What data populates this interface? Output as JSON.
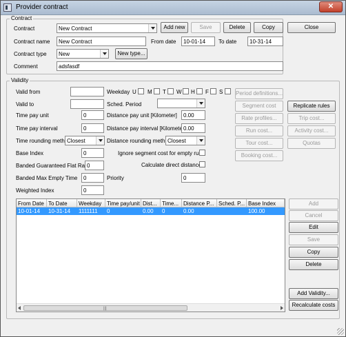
{
  "window": {
    "title": "Provider contract",
    "close_glyph": "✕"
  },
  "contract": {
    "group_label": "Contract",
    "contract_label": "Contract",
    "contract_value": "New Contract",
    "add_new": "Add new",
    "save": "Save",
    "delete": "Delete",
    "copy": "Copy",
    "name_label": "Contract name",
    "name_value": "New Contract",
    "from_date_label": "From date",
    "from_date_value": "10-01-14",
    "to_date_label": "To date",
    "to_date_value": "10-31-14",
    "type_label": "Contract type",
    "type_value": "New",
    "new_type": "New type...",
    "comment_label": "Comment",
    "comment_value": "adsfasdf"
  },
  "close_button": "Close",
  "validity": {
    "group_label": "Validity",
    "valid_from_label": "Valid from",
    "valid_from_value": "",
    "valid_to_label": "Valid to",
    "valid_to_value": "",
    "weekday_label": "Weekday",
    "weekdays": [
      "U",
      "M",
      "T",
      "W",
      "H",
      "F",
      "S"
    ],
    "sched_period_label": "Sched. Period",
    "sched_period_value": "",
    "time_pay_unit_label": "Time pay unit",
    "time_pay_unit_value": "0",
    "distance_pay_unit_label": "Distance pay unit [Kilometer]",
    "distance_pay_unit_value": "0.00",
    "time_pay_interval_label": "Time pay interval",
    "time_pay_interval_value": "0",
    "distance_pay_interval_label": "Distance pay interval [Kilometer]",
    "distance_pay_interval_value": "0.00",
    "time_rounding_label": "Time rounding meth",
    "time_rounding_value": "Closest",
    "distance_rounding_label": "Distance rounding meth",
    "distance_rounding_value": "Closest",
    "base_index_label": "Base Index",
    "base_index_value": "0",
    "ignore_segment_label": "Ignore segment cost for empty runs",
    "banded_flat_label": "Banded Guaranteed Flat Rate",
    "banded_flat_value": "0",
    "calc_direct_label": "Calculate direct distance",
    "banded_max_label": "Banded Max Empty Time",
    "banded_max_value": "0",
    "priority_label": "Priority",
    "priority_value": "0",
    "weighted_index_label": "Weighted Index",
    "weighted_index_value": "0",
    "period_definitions": "Period definitions...",
    "segment_cost": "Segment cost",
    "replicate_rules": "Replicate rules",
    "rate_profiles": "Rate profiles...",
    "trip_cost": "Trip cost...",
    "run_cost": "Run cost...",
    "activity_cost": "Activity cost...",
    "tour_cost": "Tour cost...",
    "quotas": "Quotas",
    "booking_cost": "Booking cost..."
  },
  "table": {
    "columns": [
      "From Date",
      "To Date",
      "Weekday",
      "Time pay/unit",
      "Dist...",
      "Time...",
      "Distance P...",
      "Sched. P...",
      "Base Index"
    ],
    "rows": [
      [
        "10-01-14",
        "10-31-14",
        "1111111",
        "0",
        "0.00",
        "0",
        "0.00",
        "",
        "100.00"
      ]
    ]
  },
  "side_buttons": {
    "add": "Add",
    "cancel": "Cancel",
    "edit": "Edit",
    "save": "Save",
    "copy": "Copy",
    "delete": "Delete",
    "add_validity": "Add Validity...",
    "recalculate": "Recalculate costs"
  }
}
